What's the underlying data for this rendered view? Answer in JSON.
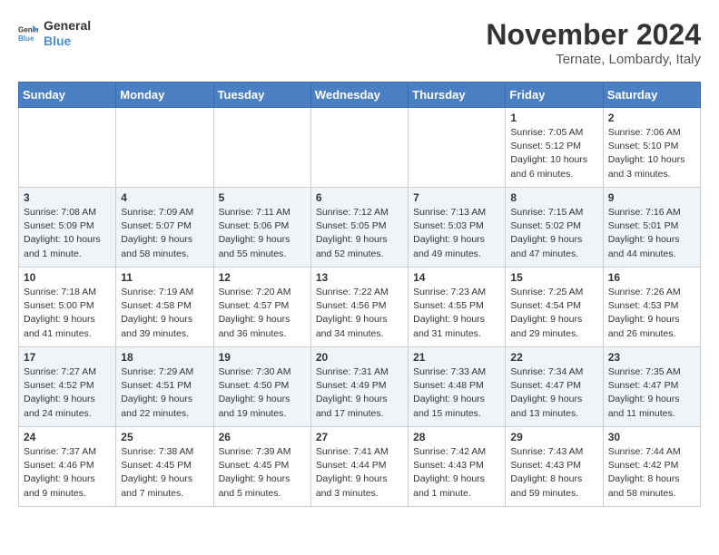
{
  "header": {
    "logo_line1": "General",
    "logo_line2": "Blue",
    "month": "November 2024",
    "location": "Ternate, Lombardy, Italy"
  },
  "days_of_week": [
    "Sunday",
    "Monday",
    "Tuesday",
    "Wednesday",
    "Thursday",
    "Friday",
    "Saturday"
  ],
  "weeks": [
    [
      {
        "day": "",
        "info": ""
      },
      {
        "day": "",
        "info": ""
      },
      {
        "day": "",
        "info": ""
      },
      {
        "day": "",
        "info": ""
      },
      {
        "day": "",
        "info": ""
      },
      {
        "day": "1",
        "info": "Sunrise: 7:05 AM\nSunset: 5:12 PM\nDaylight: 10 hours and 6 minutes."
      },
      {
        "day": "2",
        "info": "Sunrise: 7:06 AM\nSunset: 5:10 PM\nDaylight: 10 hours and 3 minutes."
      }
    ],
    [
      {
        "day": "3",
        "info": "Sunrise: 7:08 AM\nSunset: 5:09 PM\nDaylight: 10 hours and 1 minute."
      },
      {
        "day": "4",
        "info": "Sunrise: 7:09 AM\nSunset: 5:07 PM\nDaylight: 9 hours and 58 minutes."
      },
      {
        "day": "5",
        "info": "Sunrise: 7:11 AM\nSunset: 5:06 PM\nDaylight: 9 hours and 55 minutes."
      },
      {
        "day": "6",
        "info": "Sunrise: 7:12 AM\nSunset: 5:05 PM\nDaylight: 9 hours and 52 minutes."
      },
      {
        "day": "7",
        "info": "Sunrise: 7:13 AM\nSunset: 5:03 PM\nDaylight: 9 hours and 49 minutes."
      },
      {
        "day": "8",
        "info": "Sunrise: 7:15 AM\nSunset: 5:02 PM\nDaylight: 9 hours and 47 minutes."
      },
      {
        "day": "9",
        "info": "Sunrise: 7:16 AM\nSunset: 5:01 PM\nDaylight: 9 hours and 44 minutes."
      }
    ],
    [
      {
        "day": "10",
        "info": "Sunrise: 7:18 AM\nSunset: 5:00 PM\nDaylight: 9 hours and 41 minutes."
      },
      {
        "day": "11",
        "info": "Sunrise: 7:19 AM\nSunset: 4:58 PM\nDaylight: 9 hours and 39 minutes."
      },
      {
        "day": "12",
        "info": "Sunrise: 7:20 AM\nSunset: 4:57 PM\nDaylight: 9 hours and 36 minutes."
      },
      {
        "day": "13",
        "info": "Sunrise: 7:22 AM\nSunset: 4:56 PM\nDaylight: 9 hours and 34 minutes."
      },
      {
        "day": "14",
        "info": "Sunrise: 7:23 AM\nSunset: 4:55 PM\nDaylight: 9 hours and 31 minutes."
      },
      {
        "day": "15",
        "info": "Sunrise: 7:25 AM\nSunset: 4:54 PM\nDaylight: 9 hours and 29 minutes."
      },
      {
        "day": "16",
        "info": "Sunrise: 7:26 AM\nSunset: 4:53 PM\nDaylight: 9 hours and 26 minutes."
      }
    ],
    [
      {
        "day": "17",
        "info": "Sunrise: 7:27 AM\nSunset: 4:52 PM\nDaylight: 9 hours and 24 minutes."
      },
      {
        "day": "18",
        "info": "Sunrise: 7:29 AM\nSunset: 4:51 PM\nDaylight: 9 hours and 22 minutes."
      },
      {
        "day": "19",
        "info": "Sunrise: 7:30 AM\nSunset: 4:50 PM\nDaylight: 9 hours and 19 minutes."
      },
      {
        "day": "20",
        "info": "Sunrise: 7:31 AM\nSunset: 4:49 PM\nDaylight: 9 hours and 17 minutes."
      },
      {
        "day": "21",
        "info": "Sunrise: 7:33 AM\nSunset: 4:48 PM\nDaylight: 9 hours and 15 minutes."
      },
      {
        "day": "22",
        "info": "Sunrise: 7:34 AM\nSunset: 4:47 PM\nDaylight: 9 hours and 13 minutes."
      },
      {
        "day": "23",
        "info": "Sunrise: 7:35 AM\nSunset: 4:47 PM\nDaylight: 9 hours and 11 minutes."
      }
    ],
    [
      {
        "day": "24",
        "info": "Sunrise: 7:37 AM\nSunset: 4:46 PM\nDaylight: 9 hours and 9 minutes."
      },
      {
        "day": "25",
        "info": "Sunrise: 7:38 AM\nSunset: 4:45 PM\nDaylight: 9 hours and 7 minutes."
      },
      {
        "day": "26",
        "info": "Sunrise: 7:39 AM\nSunset: 4:45 PM\nDaylight: 9 hours and 5 minutes."
      },
      {
        "day": "27",
        "info": "Sunrise: 7:41 AM\nSunset: 4:44 PM\nDaylight: 9 hours and 3 minutes."
      },
      {
        "day": "28",
        "info": "Sunrise: 7:42 AM\nSunset: 4:43 PM\nDaylight: 9 hours and 1 minute."
      },
      {
        "day": "29",
        "info": "Sunrise: 7:43 AM\nSunset: 4:43 PM\nDaylight: 8 hours and 59 minutes."
      },
      {
        "day": "30",
        "info": "Sunrise: 7:44 AM\nSunset: 4:42 PM\nDaylight: 8 hours and 58 minutes."
      }
    ]
  ]
}
